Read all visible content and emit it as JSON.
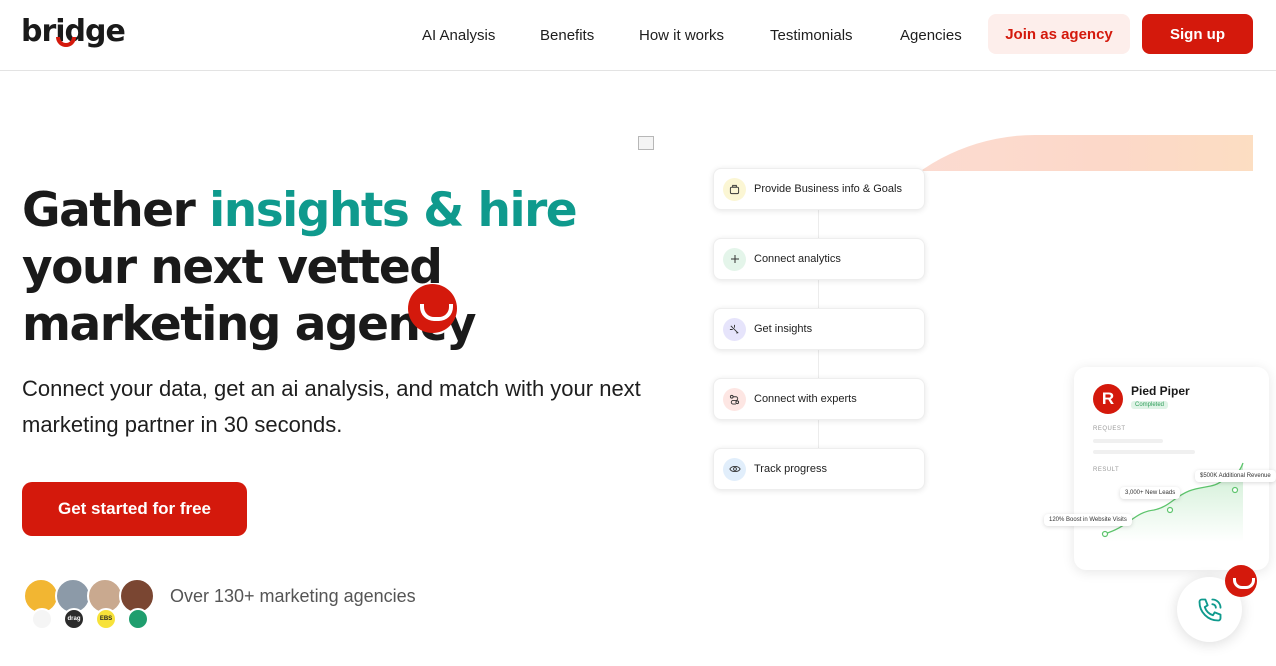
{
  "brand": {
    "name": "bridge",
    "accent": "#d4190c",
    "teal": "#0f9a8d"
  },
  "nav": {
    "links": [
      "AI Analysis",
      "Benefits",
      "How it works",
      "Testimonials",
      "Agencies"
    ],
    "join_label": "Join as agency",
    "signup_label": "Sign up"
  },
  "hero": {
    "title_part1": "Gather ",
    "title_accent": "insights & hire",
    "title_line2": "your next vetted",
    "title_line3": "marketing agency",
    "subtitle": "Connect your data, get an ai analysis, and match with your next marketing partner in 30 seconds.",
    "cta_label": "Get started for free",
    "agencies_text": "Over 130+ marketing agencies",
    "agency_badges": [
      "",
      "drag",
      "EBS",
      ""
    ]
  },
  "steps": [
    {
      "label": "Provide Business info & Goals",
      "icon": "briefcase-icon"
    },
    {
      "label": "Connect analytics",
      "icon": "plus-icon"
    },
    {
      "label": "Get insights",
      "icon": "sparkle-icon"
    },
    {
      "label": "Connect with experts",
      "icon": "route-icon"
    },
    {
      "label": "Track progress",
      "icon": "eye-icon"
    }
  ],
  "card": {
    "company": "Pied Piper",
    "status": "Completed",
    "request_label": "REQUEST",
    "result_label": "RESULT",
    "annotations": [
      "120% Boost in Website Visits",
      "3,000+ New Leads",
      "$500K Additional Revenue"
    ]
  }
}
